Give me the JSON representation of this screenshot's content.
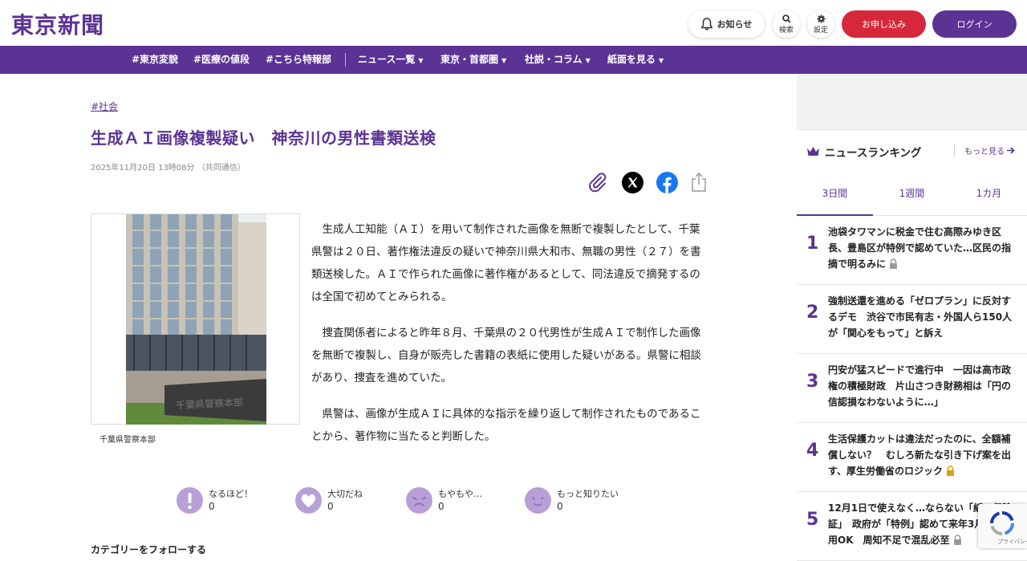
{
  "header": {
    "logo": "東京新聞",
    "notice_label": "お知らせ",
    "search_label": "検索",
    "settings_label": "設定",
    "apply_label": "お申し込み",
    "login_label": "ログイン"
  },
  "nav": {
    "items": [
      "#東京変貌",
      "#医療の値段",
      "#こちら特報部",
      "ニュース一覧",
      "東京・首都圏",
      "社説・コラム",
      "紙面を見る"
    ]
  },
  "article": {
    "tag": "#社会",
    "title": "生成ＡＩ画像複製疑い　神奈川の男性書類送検",
    "meta": "2025年11月20日 13時08分 （共同通信）",
    "caption": "千葉県警察本部",
    "photo_sign": "千葉県警察本部",
    "paragraphs": [
      "生成人工知能（ＡＩ）を用いて制作された画像を無断で複製したとして、千葉県警は２０日、著作権法違反の疑いで神奈川県大和市、無職の男性（２７）を書類送検した。ＡＩで作られた画像に著作権があるとして、同法違反で摘発するのは全国で初めてとみられる。",
      "捜査関係者によると昨年８月、千葉県の２０代男性が生成ＡＩで制作した画像を無断で複製し、自身が販売した書籍の表紙に使用した疑いがある。県警に相談があり、捜査を進めていた。",
      "県警は、画像が生成ＡＩに具体的な指示を繰り返して制作されたものであることから、著作物に当たると判断した。"
    ]
  },
  "reactions": [
    {
      "label": "なるほど！",
      "count": "0",
      "icon": "exclamation-face-icon"
    },
    {
      "label": "大切だね",
      "count": "0",
      "icon": "heart-icon"
    },
    {
      "label": "もやもや…",
      "count": "0",
      "icon": "frown-face-icon"
    },
    {
      "label": "もっと知りたい",
      "count": "0",
      "icon": "smile-face-icon"
    }
  ],
  "follow_label": "カテゴリーをフォローする",
  "ranking": {
    "title": "ニュースランキング",
    "more": "もっと見る",
    "tabs": [
      "3日間",
      "1週間",
      "1カ月"
    ],
    "active_tab": "3日間",
    "items": [
      {
        "num": "1",
        "text": "池袋タワマンに税金で住む高際みゆき区長、豊島区が特例で認めていた…区民の指摘で明るみに",
        "locked": true
      },
      {
        "num": "2",
        "text": "強制送還を進める「ゼロプラン」に反対するデモ　渋谷で市民有志・外国人ら150人が「関心をもって」と訴え",
        "locked": false
      },
      {
        "num": "3",
        "text": "円安が猛スピードで進行中　一因は高市政権の積極財政　片山さつき財務相は「円の信認損なわないように…」",
        "locked": false
      },
      {
        "num": "4",
        "text": "生活保護カットは違法だったのに、全額補償しない？　むしろ新たな引き下げ案を出す、厚生労働省のロジック",
        "locked": true
      },
      {
        "num": "5",
        "text": "12月1日で使えなく…ならない「紙の保険証」　政府が「特例」認めて来年3月まで使用OK　周知不足で混乱必至",
        "locked": true
      }
    ]
  },
  "recaptcha": {
    "text": "プライバシー・利用規約"
  },
  "colors": {
    "brand": "#5b3394",
    "apply": "#d7283b",
    "reaction": "#b99fd8"
  }
}
